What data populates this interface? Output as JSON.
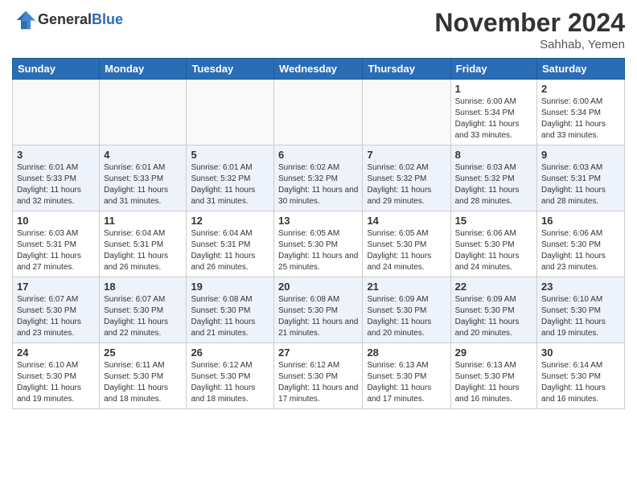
{
  "header": {
    "logo_general": "General",
    "logo_blue": "Blue",
    "month": "November 2024",
    "location": "Sahhab, Yemen"
  },
  "days_of_week": [
    "Sunday",
    "Monday",
    "Tuesday",
    "Wednesday",
    "Thursday",
    "Friday",
    "Saturday"
  ],
  "weeks": [
    [
      {
        "num": "",
        "empty": true
      },
      {
        "num": "",
        "empty": true
      },
      {
        "num": "",
        "empty": true
      },
      {
        "num": "",
        "empty": true
      },
      {
        "num": "",
        "empty": true
      },
      {
        "num": "1",
        "sunrise": "6:00 AM",
        "sunset": "5:34 PM",
        "daylight": "11 hours and 33 minutes."
      },
      {
        "num": "2",
        "sunrise": "6:00 AM",
        "sunset": "5:34 PM",
        "daylight": "11 hours and 33 minutes."
      }
    ],
    [
      {
        "num": "3",
        "sunrise": "6:01 AM",
        "sunset": "5:33 PM",
        "daylight": "11 hours and 32 minutes."
      },
      {
        "num": "4",
        "sunrise": "6:01 AM",
        "sunset": "5:33 PM",
        "daylight": "11 hours and 31 minutes."
      },
      {
        "num": "5",
        "sunrise": "6:01 AM",
        "sunset": "5:32 PM",
        "daylight": "11 hours and 31 minutes."
      },
      {
        "num": "6",
        "sunrise": "6:02 AM",
        "sunset": "5:32 PM",
        "daylight": "11 hours and 30 minutes."
      },
      {
        "num": "7",
        "sunrise": "6:02 AM",
        "sunset": "5:32 PM",
        "daylight": "11 hours and 29 minutes."
      },
      {
        "num": "8",
        "sunrise": "6:03 AM",
        "sunset": "5:32 PM",
        "daylight": "11 hours and 28 minutes."
      },
      {
        "num": "9",
        "sunrise": "6:03 AM",
        "sunset": "5:31 PM",
        "daylight": "11 hours and 28 minutes."
      }
    ],
    [
      {
        "num": "10",
        "sunrise": "6:03 AM",
        "sunset": "5:31 PM",
        "daylight": "11 hours and 27 minutes."
      },
      {
        "num": "11",
        "sunrise": "6:04 AM",
        "sunset": "5:31 PM",
        "daylight": "11 hours and 26 minutes."
      },
      {
        "num": "12",
        "sunrise": "6:04 AM",
        "sunset": "5:31 PM",
        "daylight": "11 hours and 26 minutes."
      },
      {
        "num": "13",
        "sunrise": "6:05 AM",
        "sunset": "5:30 PM",
        "daylight": "11 hours and 25 minutes."
      },
      {
        "num": "14",
        "sunrise": "6:05 AM",
        "sunset": "5:30 PM",
        "daylight": "11 hours and 24 minutes."
      },
      {
        "num": "15",
        "sunrise": "6:06 AM",
        "sunset": "5:30 PM",
        "daylight": "11 hours and 24 minutes."
      },
      {
        "num": "16",
        "sunrise": "6:06 AM",
        "sunset": "5:30 PM",
        "daylight": "11 hours and 23 minutes."
      }
    ],
    [
      {
        "num": "17",
        "sunrise": "6:07 AM",
        "sunset": "5:30 PM",
        "daylight": "11 hours and 23 minutes."
      },
      {
        "num": "18",
        "sunrise": "6:07 AM",
        "sunset": "5:30 PM",
        "daylight": "11 hours and 22 minutes."
      },
      {
        "num": "19",
        "sunrise": "6:08 AM",
        "sunset": "5:30 PM",
        "daylight": "11 hours and 21 minutes."
      },
      {
        "num": "20",
        "sunrise": "6:08 AM",
        "sunset": "5:30 PM",
        "daylight": "11 hours and 21 minutes."
      },
      {
        "num": "21",
        "sunrise": "6:09 AM",
        "sunset": "5:30 PM",
        "daylight": "11 hours and 20 minutes."
      },
      {
        "num": "22",
        "sunrise": "6:09 AM",
        "sunset": "5:30 PM",
        "daylight": "11 hours and 20 minutes."
      },
      {
        "num": "23",
        "sunrise": "6:10 AM",
        "sunset": "5:30 PM",
        "daylight": "11 hours and 19 minutes."
      }
    ],
    [
      {
        "num": "24",
        "sunrise": "6:10 AM",
        "sunset": "5:30 PM",
        "daylight": "11 hours and 19 minutes."
      },
      {
        "num": "25",
        "sunrise": "6:11 AM",
        "sunset": "5:30 PM",
        "daylight": "11 hours and 18 minutes."
      },
      {
        "num": "26",
        "sunrise": "6:12 AM",
        "sunset": "5:30 PM",
        "daylight": "11 hours and 18 minutes."
      },
      {
        "num": "27",
        "sunrise": "6:12 AM",
        "sunset": "5:30 PM",
        "daylight": "11 hours and 17 minutes."
      },
      {
        "num": "28",
        "sunrise": "6:13 AM",
        "sunset": "5:30 PM",
        "daylight": "11 hours and 17 minutes."
      },
      {
        "num": "29",
        "sunrise": "6:13 AM",
        "sunset": "5:30 PM",
        "daylight": "11 hours and 16 minutes."
      },
      {
        "num": "30",
        "sunrise": "6:14 AM",
        "sunset": "5:30 PM",
        "daylight": "11 hours and 16 minutes."
      }
    ]
  ]
}
